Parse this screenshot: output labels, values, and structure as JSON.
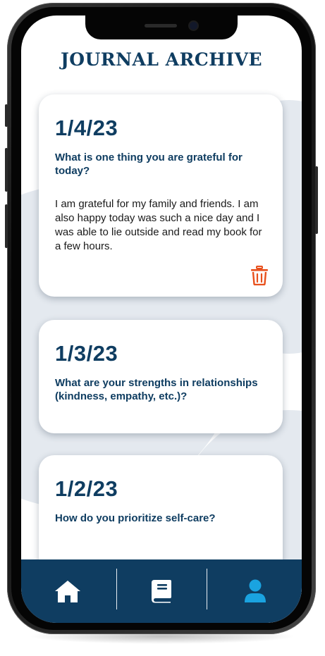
{
  "page_title": "JOURNAL ARCHIVE",
  "entries": [
    {
      "date": "1/4/23",
      "question": "What is one thing you are grateful for today?",
      "answer": "I am grateful for my family and friends. I am also happy today was such a nice day and I was able to lie outside and read my book for a few hours."
    },
    {
      "date": "1/3/23",
      "question": "What are your strengths in relationships (kindness, empathy, etc.)?",
      "answer": ""
    },
    {
      "date": "1/2/23",
      "question": "How do you prioritize self-care?",
      "answer": ""
    }
  ],
  "nav": {
    "items": [
      {
        "icon": "home-icon",
        "color": "#ffffff"
      },
      {
        "icon": "journal-book-icon",
        "color": "#ffffff"
      },
      {
        "icon": "profile-icon",
        "color": "#1aa3e0"
      }
    ]
  },
  "colors": {
    "primary": "#0f3d61",
    "delete": "#e8501c",
    "accent": "#1aa3e0",
    "background_shapes": "#e4e9ef"
  }
}
